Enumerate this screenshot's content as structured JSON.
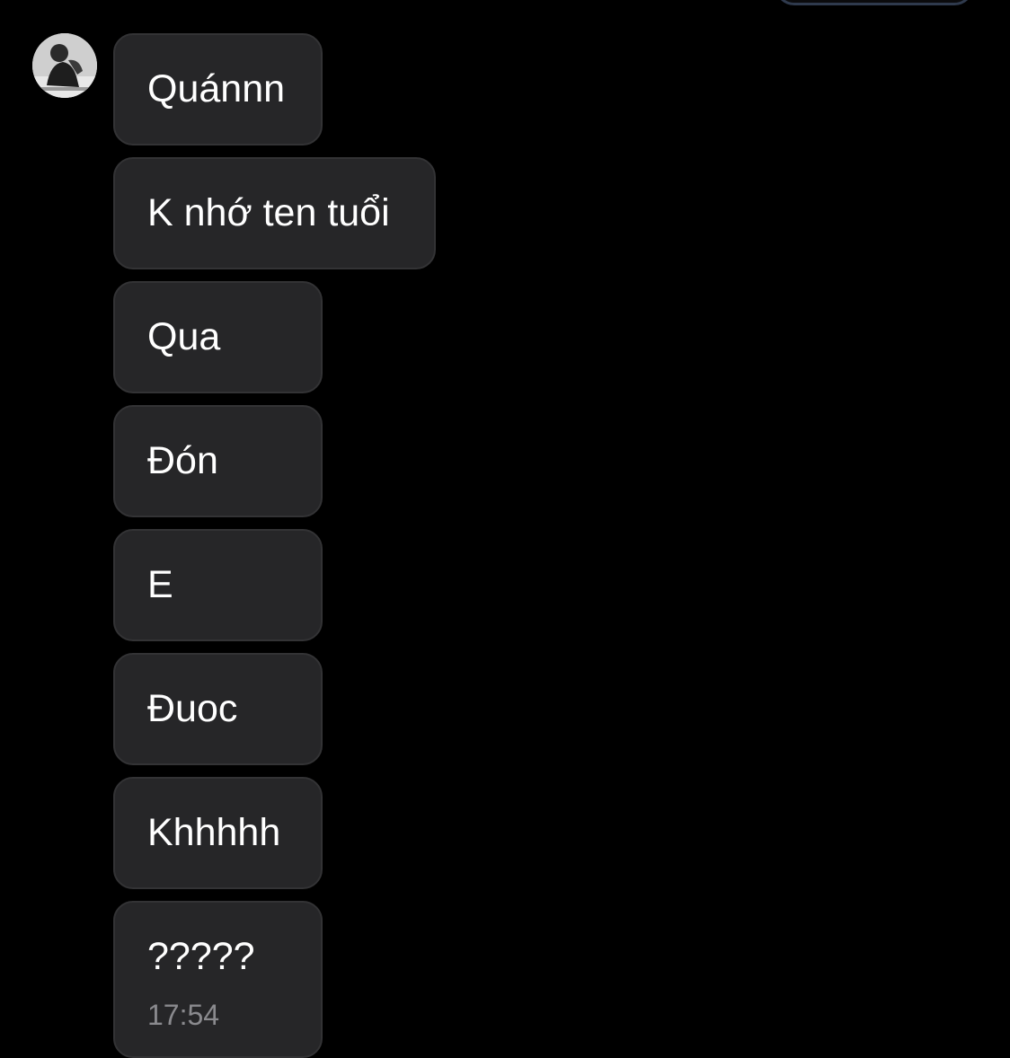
{
  "contact": {
    "avatar_icon": "profile-photo-icon"
  },
  "messages": [
    {
      "text": "Quánnn"
    },
    {
      "text": "K nhớ ten tuổi"
    },
    {
      "text": "Qua"
    },
    {
      "text": "Đón"
    },
    {
      "text": "E"
    },
    {
      "text": "Đuoc"
    },
    {
      "text": "Khhhhh"
    },
    {
      "text": "?????",
      "time": "17:54"
    }
  ],
  "colors": {
    "background": "#000000",
    "bubble_incoming": "#262628",
    "text": "#ffffff",
    "timestamp": "#8a8a8e"
  }
}
